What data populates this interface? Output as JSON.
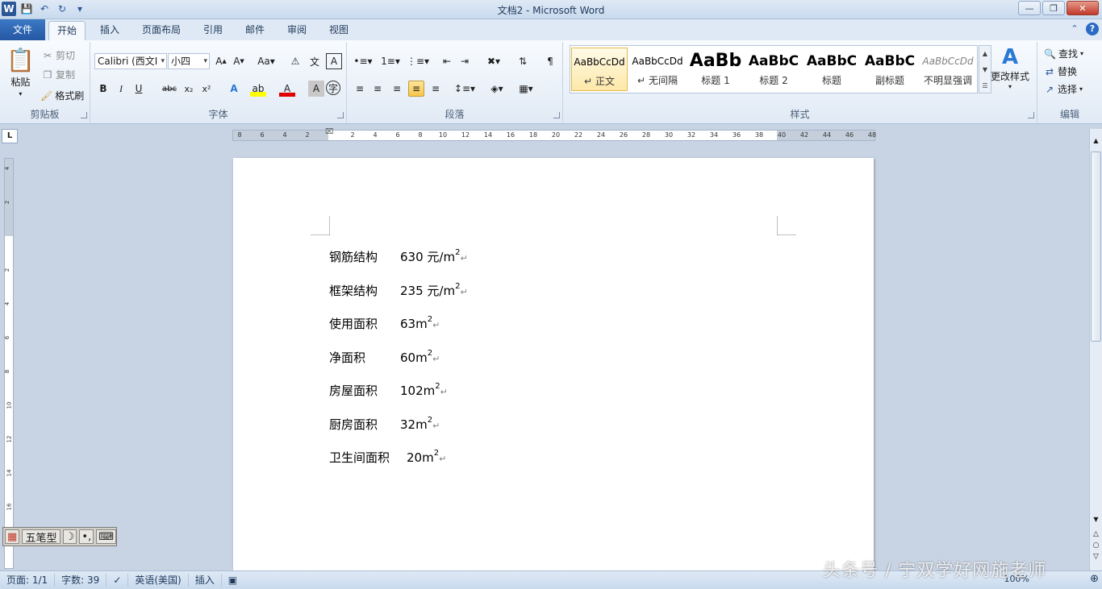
{
  "window": {
    "title": "文档2 - Microsoft Word"
  },
  "tabs": [
    "文件",
    "开始",
    "插入",
    "页面布局",
    "引用",
    "邮件",
    "审阅",
    "视图"
  ],
  "ribbon": {
    "clipboard": {
      "label": "剪贴板",
      "paste": "粘贴",
      "cut": "剪切",
      "copy": "复制",
      "format_painter": "格式刷"
    },
    "font": {
      "label": "字体",
      "font_name": "Calibri (西文I",
      "font_size": "小四"
    },
    "paragraph": {
      "label": "段落"
    },
    "styles": {
      "label": "样式",
      "items": [
        {
          "preview": "AaBbCcDd",
          "name": "正文"
        },
        {
          "preview": "AaBbCcDd",
          "name": "无间隔"
        },
        {
          "preview": "AaBb",
          "name": "标题 1"
        },
        {
          "preview": "AaBbC",
          "name": "标题 2"
        },
        {
          "preview": "AaBbC",
          "name": "标题"
        },
        {
          "preview": "AaBbC",
          "name": "副标题"
        },
        {
          "preview": "AaBbCcDd",
          "name": "不明显强调"
        }
      ],
      "change_styles": "更改样式"
    },
    "editing": {
      "label": "编辑",
      "find": "查找",
      "replace": "替换",
      "select": "选择"
    }
  },
  "ruler": {
    "ticks": [
      "8",
      "6",
      "4",
      "2",
      "",
      "2",
      "4",
      "6",
      "8",
      "10",
      "12",
      "14",
      "16",
      "18",
      "20",
      "22",
      "24",
      "26",
      "28",
      "30",
      "32",
      "34",
      "36",
      "38",
      "40",
      "42",
      "44",
      "46",
      "48"
    ],
    "vticks": [
      "4",
      "2",
      "",
      "2",
      "4",
      "6",
      "8",
      "10",
      "12",
      "14",
      "16"
    ]
  },
  "document": {
    "lines": [
      {
        "label": "钢筋结构",
        "value": "630 元/m",
        "sup": "2"
      },
      {
        "label": "框架结构",
        "value": "235 元/m",
        "sup": "2"
      },
      {
        "label": "使用面积",
        "value": "63m",
        "sup": "2"
      },
      {
        "label": "净面积",
        "value": "60m",
        "sup": "2"
      },
      {
        "label": "房屋面积",
        "value": "102m",
        "sup": "2"
      },
      {
        "label": "厨房面积",
        "value": "32m",
        "sup": "2"
      },
      {
        "label": "卫生间面积",
        "value": "20m",
        "sup": "2"
      }
    ],
    "para_mark": "↵"
  },
  "ime": {
    "mode": "五笔型"
  },
  "status": {
    "page": "页面: 1/1",
    "words": "字数: 39",
    "language": "英语(美国)",
    "insert_mode": "插入",
    "zoom": "100%"
  },
  "watermark": "头条号 / 宁双学好网施老师"
}
